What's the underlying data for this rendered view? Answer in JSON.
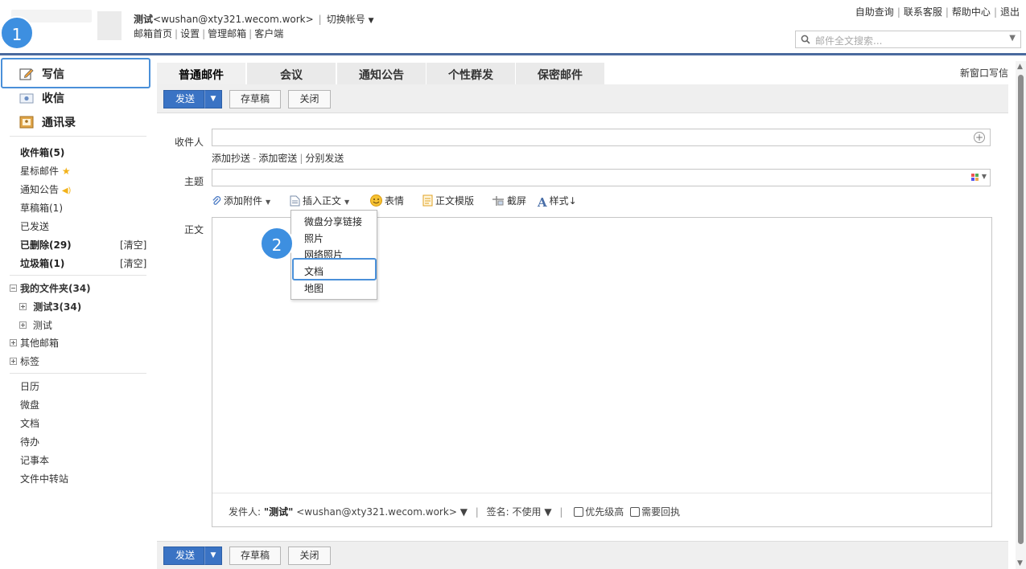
{
  "header": {
    "account_name": "测试",
    "account_email": "<wushan@xty321.wecom.work>",
    "switch_account": "切换帐号",
    "nav_links": [
      "邮箱首页",
      "设置",
      "管理邮箱",
      "客户端"
    ],
    "top_links": [
      "自助查询",
      "联系客服",
      "帮助中心",
      "退出"
    ],
    "search_placeholder": "邮件全文搜索..."
  },
  "sidebar": {
    "write": "写信",
    "inbox": "收信",
    "contacts": "通讯录",
    "folders": [
      {
        "label": "收件箱(5)",
        "bold": true
      },
      {
        "label": "星标邮件",
        "bold": false
      },
      {
        "label": "通知公告",
        "bold": false
      },
      {
        "label": "草稿箱(1)",
        "bold": false
      },
      {
        "label": "已发送",
        "bold": false
      },
      {
        "label": "已删除(29)",
        "bold": true,
        "action": "[清空]"
      },
      {
        "label": "垃圾箱(1)",
        "bold": true,
        "action": "[清空]"
      }
    ],
    "my_folders": "我的文件夹(34)",
    "my_folder_children": [
      "测试3(34)",
      "测试"
    ],
    "other_mailboxes": "其他邮箱",
    "tags": "标签",
    "apps": [
      "日历",
      "微盘",
      "文档",
      "待办",
      "记事本",
      "文件中转站"
    ]
  },
  "annotations": {
    "step1": "1",
    "step2": "2"
  },
  "compose": {
    "tabs": [
      "普通邮件",
      "会议",
      "通知公告",
      "个性群发",
      "保密邮件"
    ],
    "new_window": "新窗口写信",
    "send": "发送",
    "save_draft": "存草稿",
    "close": "关闭",
    "to_label": "收件人",
    "cc_links": [
      "添加抄送",
      "添加密送",
      "分别发送"
    ],
    "subject_label": "主题",
    "body_label": "正文",
    "tools": {
      "attach": "添加附件",
      "insert": "插入正文",
      "emoji": "表情",
      "template": "正文模版",
      "screenshot": "截屏",
      "style": "样式"
    },
    "insert_menu": [
      "微盘分享链接",
      "照片",
      "网络照片",
      "文档",
      "地图"
    ],
    "sender_label": "发件人:",
    "sender_name": "\"测试\"",
    "sender_email": "<wushan@xty321.wecom.work>",
    "signature": "签名: 不使用",
    "priority": "优先级高",
    "receipt": "需要回执"
  },
  "colors": {
    "accent": "#3a73c4",
    "highlight": "#4a90d9",
    "header_line": "#4a6a9e"
  }
}
